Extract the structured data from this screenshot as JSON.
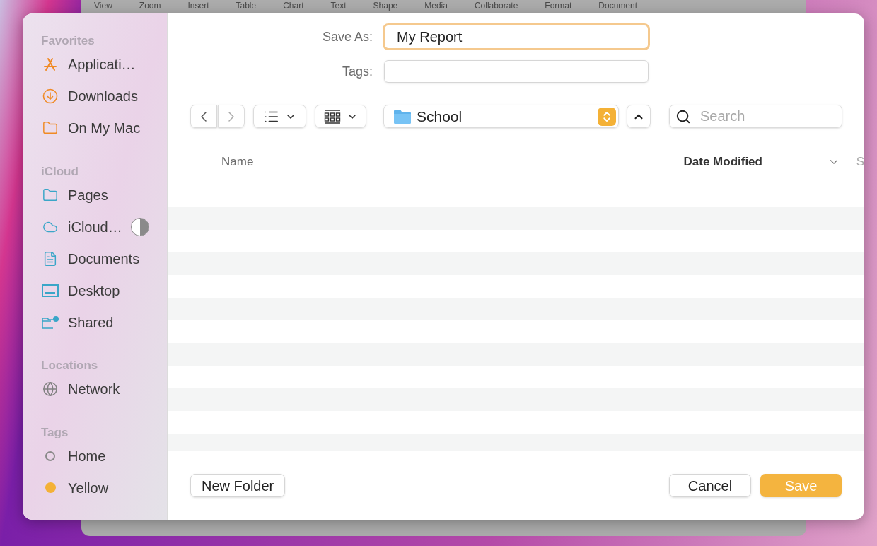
{
  "background_menu": [
    "View",
    "Zoom",
    "Insert",
    "Table",
    "Chart",
    "Text",
    "Shape",
    "Media",
    "Collaborate",
    "Format",
    "Document"
  ],
  "sidebar": {
    "sections": [
      {
        "title": "Favorites",
        "items": [
          {
            "label": "Applicati…",
            "kind": "app",
            "color": "#f08a24"
          },
          {
            "label": "Downloads",
            "kind": "download",
            "color": "#f08a24"
          },
          {
            "label": "On My Mac",
            "kind": "folder",
            "color": "#f08a24"
          }
        ]
      },
      {
        "title": "iCloud",
        "items": [
          {
            "label": "Pages",
            "kind": "folder",
            "color": "#3aa6c8"
          },
          {
            "label": "iCloud…",
            "kind": "cloud",
            "color": "#3aa6c8",
            "level": 0.5
          },
          {
            "label": "Documents",
            "kind": "document",
            "color": "#3aa6c8"
          },
          {
            "label": "Desktop",
            "kind": "desktop",
            "color": "#3aa6c8"
          },
          {
            "label": "Shared",
            "kind": "shared",
            "color": "#3aa6c8"
          }
        ]
      },
      {
        "title": "Locations",
        "items": [
          {
            "label": "Network",
            "kind": "network",
            "color": "#808080"
          }
        ]
      },
      {
        "title": "Tags",
        "items": [
          {
            "label": "Home",
            "kind": "tag-empty",
            "color": "#8a8a8a"
          },
          {
            "label": "Yellow",
            "kind": "tag",
            "color": "#f4b136"
          }
        ]
      }
    ]
  },
  "save_as": {
    "label": "Save As:",
    "value": "My Report"
  },
  "tags": {
    "label": "Tags:"
  },
  "location": {
    "label": "School"
  },
  "search": {
    "placeholder": "Search"
  },
  "table": {
    "columns": [
      {
        "label": "Name",
        "sorted": false
      },
      {
        "label": "Date Modified",
        "sorted": true
      },
      {
        "label": "S",
        "sorted": false
      }
    ]
  },
  "buttons": {
    "new_folder": "New Folder",
    "cancel": "Cancel",
    "save": "Save"
  }
}
